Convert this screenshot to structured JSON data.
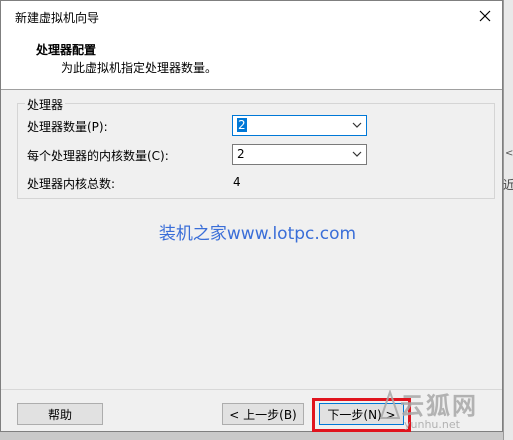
{
  "dialog": {
    "title": "新建虚拟机向导",
    "header_title": "处理器配置",
    "header_subtitle": "为此虚拟机指定处理器数量。"
  },
  "processor_group": {
    "legend": "处理器",
    "processor_count_label": "处理器数量(P):",
    "processor_count_value": "2",
    "cores_per_processor_label": "每个处理器的内核数量(C):",
    "cores_per_processor_value": "2",
    "total_cores_label": "处理器内核总数:",
    "total_cores_value": "4"
  },
  "watermark": "装机之家www.lotpc.com",
  "buttons": {
    "help": "帮助",
    "back": "< 上一步(B)",
    "next": "下一步(N) >"
  },
  "logo": {
    "text_cn": "云狐网",
    "text_en": "yunhu.net"
  },
  "colors": {
    "accent": "#0078d7",
    "highlight": "#e0141e",
    "watermark": "#3a6ed8"
  }
}
